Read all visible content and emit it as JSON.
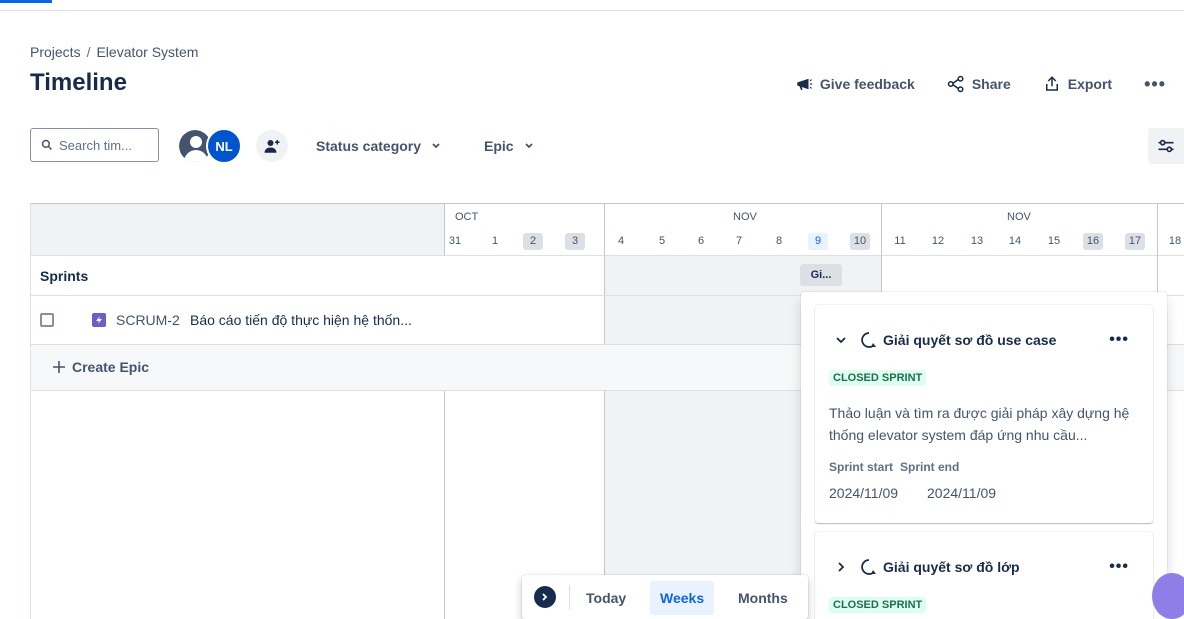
{
  "breadcrumb": {
    "root": "Projects",
    "separator": "/",
    "project": "Elevator System"
  },
  "page_title": "Timeline",
  "header_actions": {
    "feedback": "Give feedback",
    "share": "Share",
    "export": "Export",
    "more": "•••"
  },
  "filters": {
    "search_placeholder": "Search tim...",
    "avatar_initials": "NL",
    "status_category": "Status category",
    "epic": "Epic"
  },
  "calendar": {
    "months": [
      "OCT",
      "NOV",
      "NOV"
    ],
    "days": [
      "31",
      "1",
      "2",
      "3",
      "4",
      "5",
      "6",
      "7",
      "8",
      "9",
      "10",
      "11",
      "12",
      "13",
      "14",
      "15",
      "16",
      "17",
      "18"
    ],
    "today": "9"
  },
  "rows": {
    "sprints_label": "Sprints",
    "sprint_bar_label": "Gi...",
    "epic_key": "SCRUM-2",
    "epic_summary": "Báo cáo tiến độ thực hiện hệ thốn...",
    "create_epic": "Create Epic"
  },
  "sprint_panel": {
    "cards": [
      {
        "name": "Giải quyết sơ đồ use case",
        "badge": "CLOSED SPRINT",
        "description": "Thảo luận và tìm ra được giải pháp xây dựng hệ thống elevator system đáp ứng nhu cầu...",
        "start_label": "Sprint start",
        "end_label": "Sprint end",
        "start": "2024/11/09",
        "end": "2024/11/09",
        "more": "•••"
      },
      {
        "name": "Giải quyết sơ đồ lớp",
        "badge": "CLOSED SPRINT",
        "more": "•••"
      }
    ]
  },
  "view_switcher": {
    "today": "Today",
    "weeks": "Weeks",
    "months": "Months",
    "selected": "Weeks"
  },
  "colors": {
    "accent": "#0c66e4",
    "closed_badge_bg": "#dcfff1",
    "closed_badge_text": "#216e4e",
    "epic_purple": "#6e5dc6"
  }
}
